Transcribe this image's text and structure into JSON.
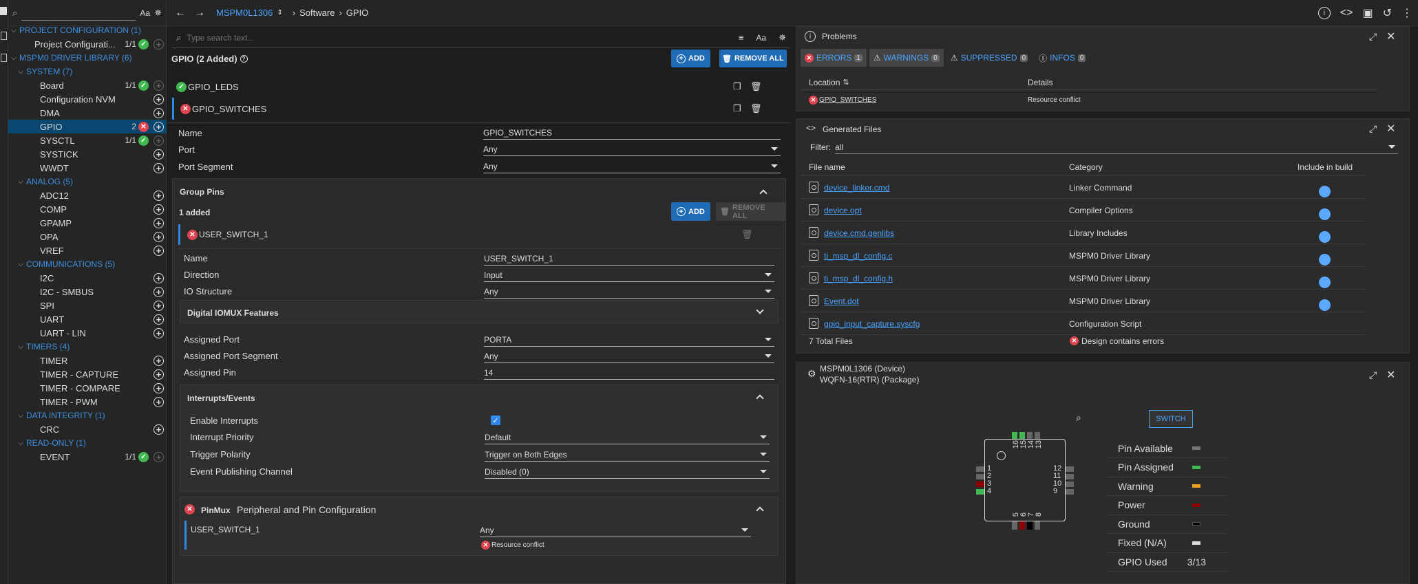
{
  "topbar": {
    "breadcrumb_device": "MSPM0L1306",
    "breadcrumb_category": "Software",
    "breadcrumb_module": "GPIO"
  },
  "sidebar": {
    "search_case": "Aa",
    "sections": [
      {
        "label": "PROJECT CONFIGURATION (1)"
      },
      {
        "label": "MSPM0 DRIVER LIBRARY (6)"
      },
      {
        "label": "SYSTEM (7)"
      },
      {
        "label": "ANALOG (5)"
      },
      {
        "label": "COMMUNICATIONS (5)"
      },
      {
        "label": "TIMERS (4)"
      },
      {
        "label": "DATA INTEGRITY (1)"
      },
      {
        "label": "READ-ONLY (1)"
      }
    ],
    "items": [
      {
        "label": "Project Configurati...",
        "count": "1/1"
      },
      {
        "label": "Board",
        "count": "1/1"
      },
      {
        "label": "Configuration NVM",
        "count": ""
      },
      {
        "label": "DMA",
        "count": ""
      },
      {
        "label": "GPIO",
        "count": "2"
      },
      {
        "label": "SYSCTL",
        "count": "1/1"
      },
      {
        "label": "SYSTICK",
        "count": ""
      },
      {
        "label": "WWDT",
        "count": ""
      },
      {
        "label": "ADC12",
        "count": ""
      },
      {
        "label": "COMP",
        "count": ""
      },
      {
        "label": "GPAMP",
        "count": ""
      },
      {
        "label": "OPA",
        "count": ""
      },
      {
        "label": "VREF",
        "count": ""
      },
      {
        "label": "I2C",
        "count": ""
      },
      {
        "label": "I2C - SMBUS",
        "count": ""
      },
      {
        "label": "SPI",
        "count": ""
      },
      {
        "label": "UART",
        "count": ""
      },
      {
        "label": "UART - LIN",
        "count": ""
      },
      {
        "label": "TIMER",
        "count": ""
      },
      {
        "label": "TIMER - CAPTURE",
        "count": ""
      },
      {
        "label": "TIMER - COMPARE",
        "count": ""
      },
      {
        "label": "TIMER - PWM",
        "count": ""
      },
      {
        "label": "CRC",
        "count": ""
      },
      {
        "label": "EVENT",
        "count": "1/1"
      }
    ]
  },
  "center": {
    "search_placeholder": "Type search text...",
    "search_case": "Aa",
    "title": "GPIO (2 Added)",
    "add_label": "ADD",
    "remove_all_label": "REMOVE ALL",
    "instances": [
      {
        "name": "GPIO_LEDS"
      },
      {
        "name": "GPIO_SWITCHES"
      }
    ],
    "fields": {
      "name_label": "Name",
      "name_value": "GPIO_SWITCHES",
      "port_label": "Port",
      "port_value": "Any",
      "segment_label": "Port Segment",
      "segment_value": "Any"
    },
    "group_pins": {
      "title": "Group Pins",
      "count": "1 added",
      "add_label": "ADD",
      "remove_all_label": "REMOVE ALL",
      "pin_name": "USER_SWITCH_1",
      "name_label": "Name",
      "name_value": "USER_SWITCH_1",
      "direction_label": "Direction",
      "direction_value": "Input",
      "io_label": "IO Structure",
      "io_value": "Any",
      "iomux_title": "Digital IOMUX Features",
      "assigned_port_label": "Assigned Port",
      "assigned_port_value": "PORTA",
      "assigned_segment_label": "Assigned Port Segment",
      "assigned_segment_value": "Any",
      "assigned_pin_label": "Assigned Pin",
      "assigned_pin_value": "14",
      "interrupts_title": "Interrupts/Events",
      "enable_label": "Enable Interrupts",
      "priority_label": "Interrupt Priority",
      "priority_value": "Default",
      "polarity_label": "Trigger Polarity",
      "polarity_value": "Trigger on Both Edges",
      "channel_label": "Event Publishing Channel",
      "channel_value": "Disabled (0)",
      "pinmux_tag": "PinMux",
      "pinmux_title": "Peripheral and Pin Configuration",
      "pinmux_pin": "USER_SWITCH_1",
      "pinmux_value": "Any",
      "pinmux_error": "Resource conflict"
    }
  },
  "problems": {
    "title": "Problems",
    "tabs": [
      {
        "label": "ERRORS",
        "count": "1"
      },
      {
        "label": "WARNINGS",
        "count": "0"
      },
      {
        "label": "SUPPRESSED",
        "count": "0"
      },
      {
        "label": "INFOS",
        "count": "0"
      }
    ],
    "col_location": "Location",
    "col_details": "Details",
    "row_location": "GPIO_SWITCHES",
    "row_details": "Resource conflict"
  },
  "generated": {
    "title": "Generated Files",
    "filter_label": "Filter:",
    "filter_value": "all",
    "col_file": "File name",
    "col_category": "Category",
    "col_include": "Include in build",
    "files": [
      {
        "name": "device_linker.cmd",
        "category": "Linker Command"
      },
      {
        "name": "device.opt",
        "category": "Compiler Options"
      },
      {
        "name": "device.cmd.genlibs",
        "category": "Library Includes"
      },
      {
        "name": "ti_msp_dl_config.c",
        "category": "MSPM0 Driver Library"
      },
      {
        "name": "ti_msp_dl_config.h",
        "category": "MSPM0 Driver Library"
      },
      {
        "name": "Event.dot",
        "category": "MSPM0 Driver Library"
      },
      {
        "name": "gpio_input_capture.syscfg",
        "category": "Configuration Script"
      }
    ],
    "total": "7 Total Files",
    "status": "Design contains errors"
  },
  "device": {
    "name": "MSPM0L1306 (Device)",
    "package": "WQFN-16(RTR) (Package)",
    "switch_label": "SWITCH",
    "pins_top": [
      "16",
      "15",
      "14",
      "13"
    ],
    "pins_left": [
      "1",
      "2",
      "3",
      "4"
    ],
    "pins_right": [
      "12",
      "11",
      "10",
      "9"
    ],
    "pins_bottom": [
      "5",
      "6",
      "7",
      "8"
    ],
    "legend": [
      {
        "label": "Pin Available",
        "color": "#777777"
      },
      {
        "label": "Pin Assigned",
        "color": "#3fb950"
      },
      {
        "label": "Warning",
        "color": "#f0a020"
      },
      {
        "label": "Power",
        "color": "#8b0000"
      },
      {
        "label": "Ground",
        "color": "#000000"
      },
      {
        "label": "Fixed (N/A)",
        "color": "#dddddd"
      },
      {
        "label": "GPIO Used",
        "value": "3/13"
      }
    ]
  }
}
